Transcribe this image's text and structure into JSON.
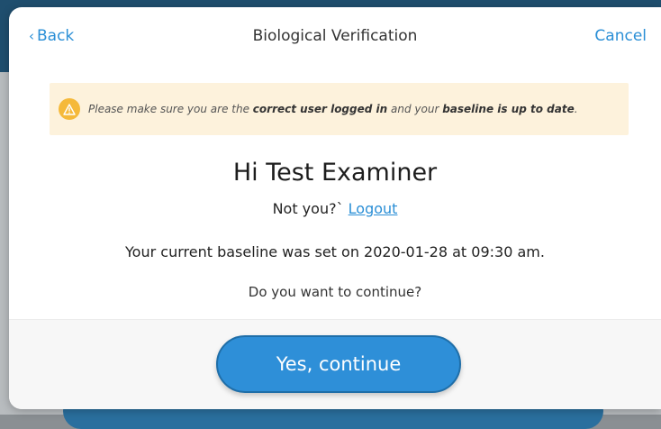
{
  "header": {
    "back_chevron": "‹",
    "back_label": "Back",
    "title": "Biological Verification",
    "cancel_label": "Cancel"
  },
  "alert": {
    "icon": "warning-icon",
    "text_1": "Please make sure you are the ",
    "bold_1": "correct user logged in",
    "text_2": " and your ",
    "bold_2": "baseline is up to date",
    "text_3": "."
  },
  "greeting": "Hi Test Examiner",
  "not_you": {
    "prompt": "Not you?` ",
    "logout_label": "Logout"
  },
  "baseline_text": "Your current baseline was set on 2020-01-28 at 09:30 am.",
  "question": "Do you want to continue?",
  "continue_label": "Yes, continue",
  "colors": {
    "accent": "#2e8fd8",
    "link": "#2b8fd6",
    "alert_bg": "#fdf2dc",
    "warning": "#f5b93a"
  }
}
